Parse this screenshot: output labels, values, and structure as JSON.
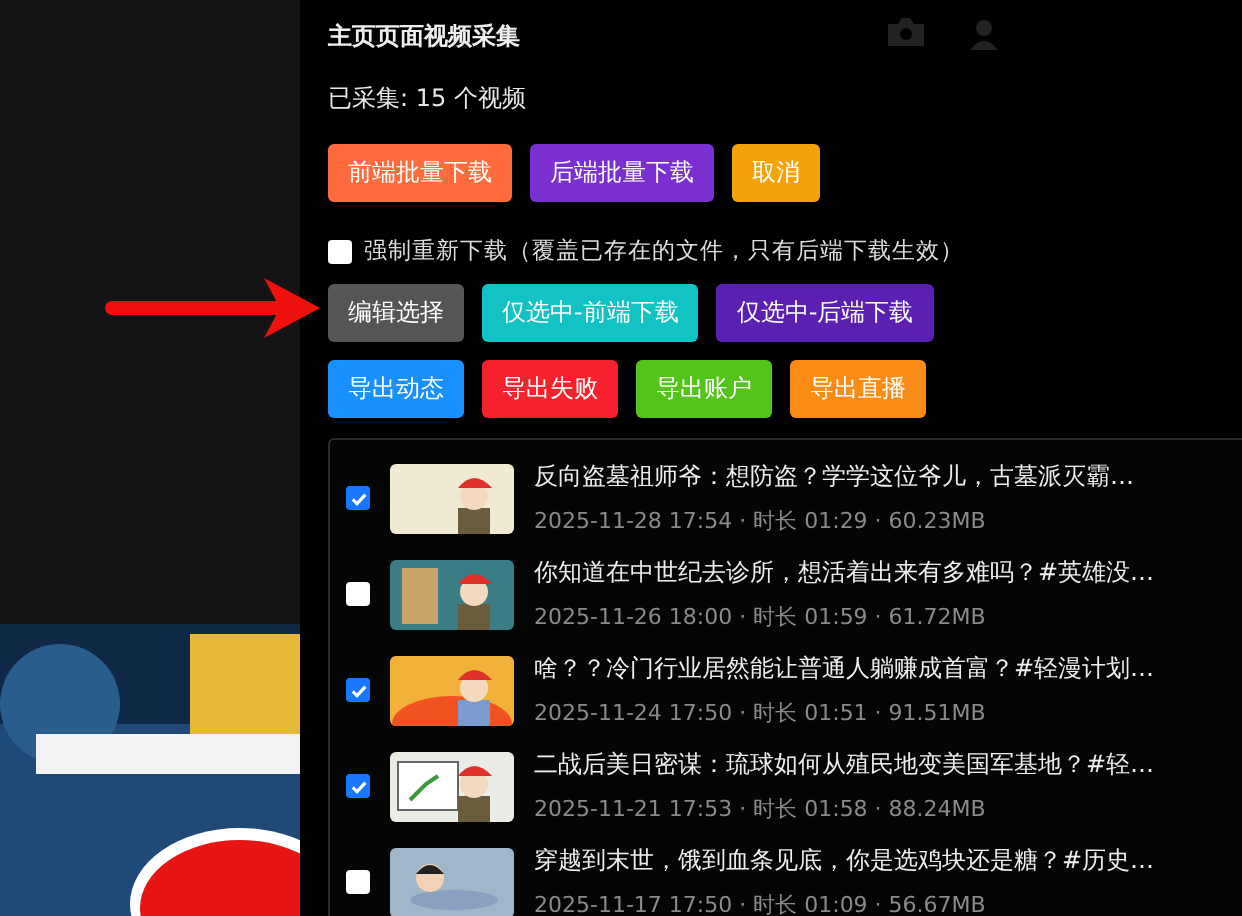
{
  "panel": {
    "title": "主页页面视频采集",
    "count": "已采集: 15 个视频"
  },
  "action_rows": [
    [
      {
        "label": "前端批量下载",
        "color": "#ff6b3d"
      },
      {
        "label": "后端批量下载",
        "color": "#7b2fd1"
      },
      {
        "label": "取消",
        "color": "#f5a20a"
      }
    ]
  ],
  "force_redownload": {
    "label": "强制重新下载（覆盖已存在的文件，只有后端下载生效）",
    "checked": false
  },
  "selection_rows": [
    [
      {
        "label": "编辑选择",
        "color": "#555555"
      },
      {
        "label": "仅选中-前端下载",
        "color": "#13c2c2"
      },
      {
        "label": "仅选中-后端下载",
        "color": "#5b1fb2"
      }
    ],
    [
      {
        "label": "导出动态",
        "color": "#1890ff"
      },
      {
        "label": "导出失败",
        "color": "#f5222d"
      },
      {
        "label": "导出账户",
        "color": "#52c41a"
      },
      {
        "label": "导出直播",
        "color": "#fa8c16"
      }
    ]
  ],
  "videos": [
    {
      "title": "反向盗墓祖师爷：想防盗？学学这位爷儿，古墓派灭霸…",
      "meta": "2025-11-28 17:54 · 时长 01:29 · 60.23MB",
      "checked": true
    },
    {
      "title": "你知道在中世纪去诊所，想活着出来有多难吗？#英雄没…",
      "meta": "2025-11-26 18:00 · 时长 01:59 · 61.72MB",
      "checked": false
    },
    {
      "title": "啥？？冷门行业居然能让普通人躺赚成首富？#轻漫计划…",
      "meta": "2025-11-24 17:50 · 时长 01:51 · 91.51MB",
      "checked": true
    },
    {
      "title": "二战后美日密谋：琉球如何从殖民地变美国军基地？#轻…",
      "meta": "2025-11-21 17:53 · 时长 01:58 · 88.24MB",
      "checked": true
    },
    {
      "title": "穿越到末世，饿到血条见底，你是选鸡块还是糖？#历史…",
      "meta": "2025-11-17 17:50 · 时长 01:09 · 56.67MB",
      "checked": false
    }
  ]
}
